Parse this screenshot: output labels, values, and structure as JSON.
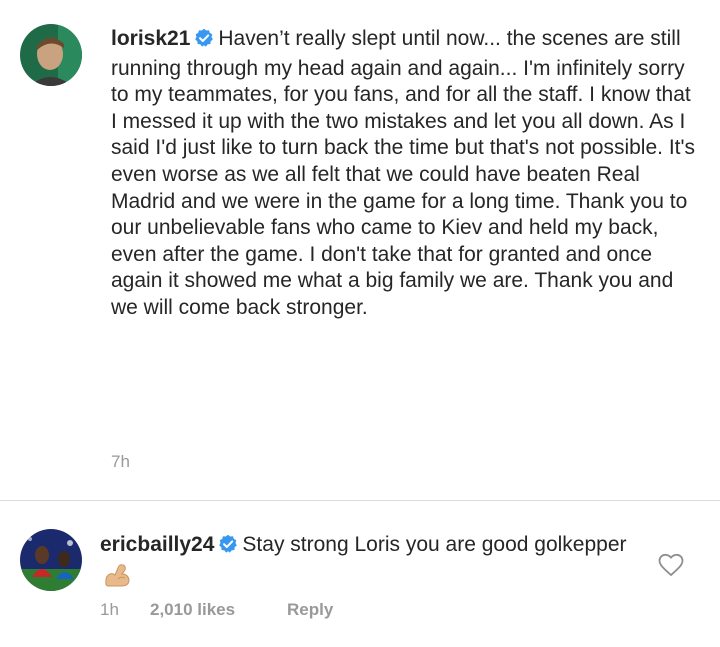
{
  "post": {
    "username": "lorisk21",
    "caption": "Haven’t really slept until now... the scenes are still running through my head again and again... I'm infinitely sorry to my teammates, for you fans, and for all the staff. I know that I messed it up with the two mistakes and let you all down. As I said I'd just like to turn back the time but that's not possible. It's even worse as we all felt that we could have beaten Real Madrid and we were in the game for a long time. Thank you to our unbelievable fans who came to Kiev and held my back, even after the game. I don't take that for granted and once again it showed me what a big family we are. Thank you and we will come back stronger.",
    "time": "7h"
  },
  "comment": {
    "username": "ericbailly24",
    "text": "Stay strong Loris you are good golkepper",
    "emoji": "flexed-biceps-emoji",
    "time": "1h",
    "likes": "2,010 likes",
    "reply_label": "Reply"
  },
  "colors": {
    "text": "#262626",
    "muted": "#999999",
    "verified_blue": "#3897f0",
    "divider": "#dbdbdb"
  },
  "icons": {
    "verified": "verified-badge-icon",
    "like": "heart-outline-icon"
  }
}
